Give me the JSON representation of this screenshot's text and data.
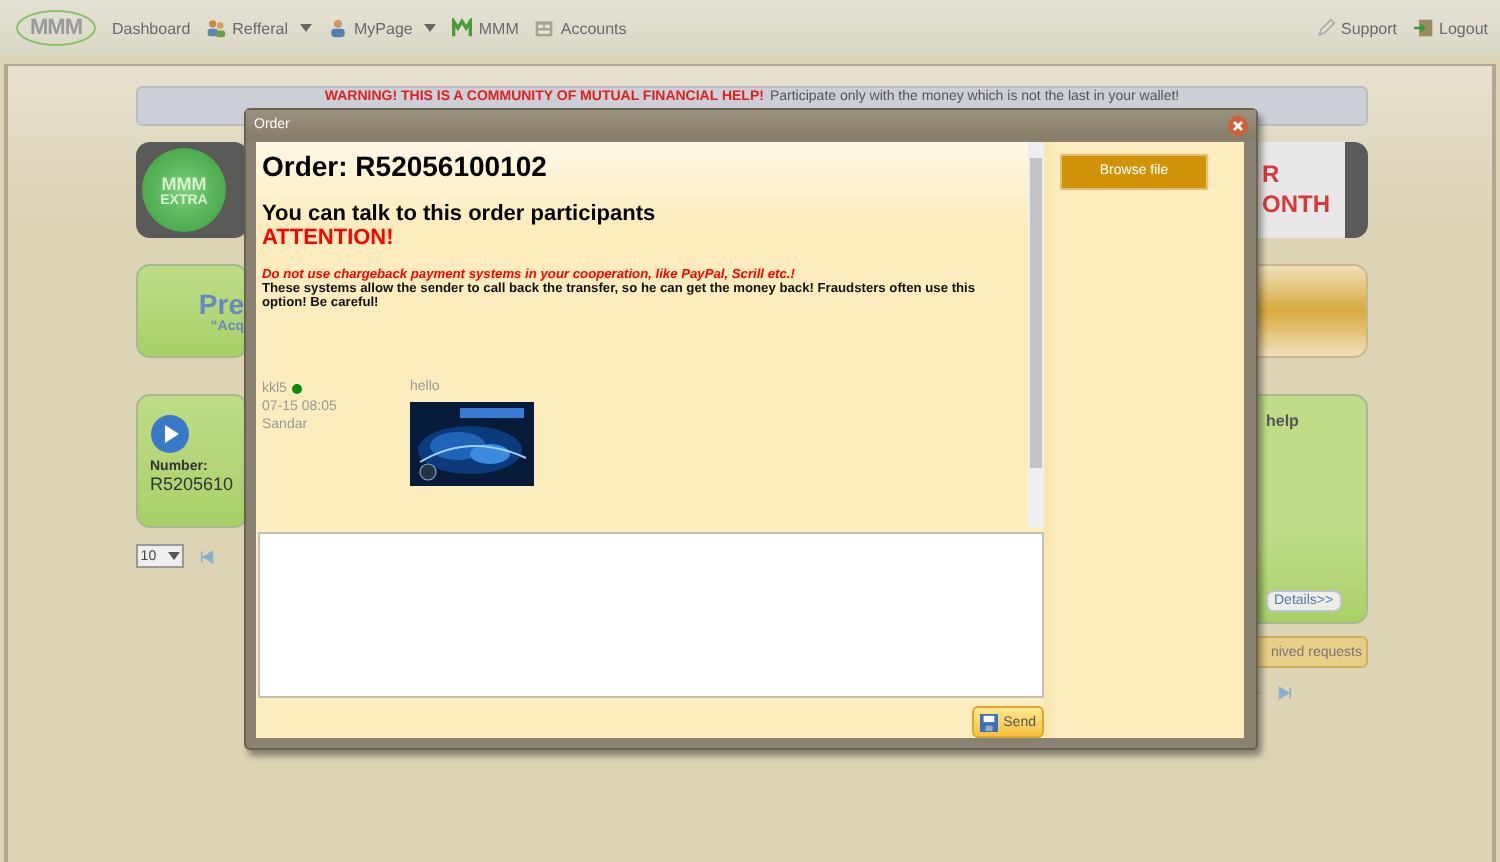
{
  "nav": {
    "logo": "MMM",
    "items": [
      {
        "label": "Dashboard",
        "has_menu": false
      },
      {
        "label": "Refferal",
        "has_menu": true
      },
      {
        "label": "MyPage",
        "has_menu": true
      },
      {
        "label": "MMM",
        "has_menu": false
      },
      {
        "label": "Accounts",
        "has_menu": false
      }
    ],
    "right_items": [
      {
        "label": "Support"
      },
      {
        "label": "Logout"
      }
    ]
  },
  "warning": {
    "alert": "WARNING! THIS IS A COMMUNITY OF MUTUAL FINANCIAL HELP!",
    "note": "Participate only with the money which is not the last in your wallet!"
  },
  "extra_banner": {
    "mark": "MMM",
    "label": "EXTRA"
  },
  "month_banner": {
    "line_1": "R",
    "line_2": "ONTH"
  },
  "promo_card": {
    "title": "Pre",
    "subtitle": "“Acq"
  },
  "order_card": {
    "number_label": "Number:",
    "number": "R5205610"
  },
  "help_card": {
    "title": "help",
    "button": "Details>>"
  },
  "page_size": "10",
  "archived_button": "nived requests",
  "dialog": {
    "title": "Order",
    "heading": "Order: R52056100102",
    "subheading": "You can talk to this order participants",
    "attention": "ATTENTION!",
    "caution": "Do not use chargeback payment systems in your cooperation, like PayPal, Scrill etc.!",
    "explanation": "These systems allow the sender to call back the transfer, so he can get the money back! Fraudsters often use this option! Be careful!",
    "messages": [
      {
        "author": "kkl5",
        "online": true,
        "time": "07-15 08:05",
        "name": "Sandar",
        "text": "hello"
      }
    ],
    "browse_button": "Browse file",
    "send_button": "Send"
  }
}
